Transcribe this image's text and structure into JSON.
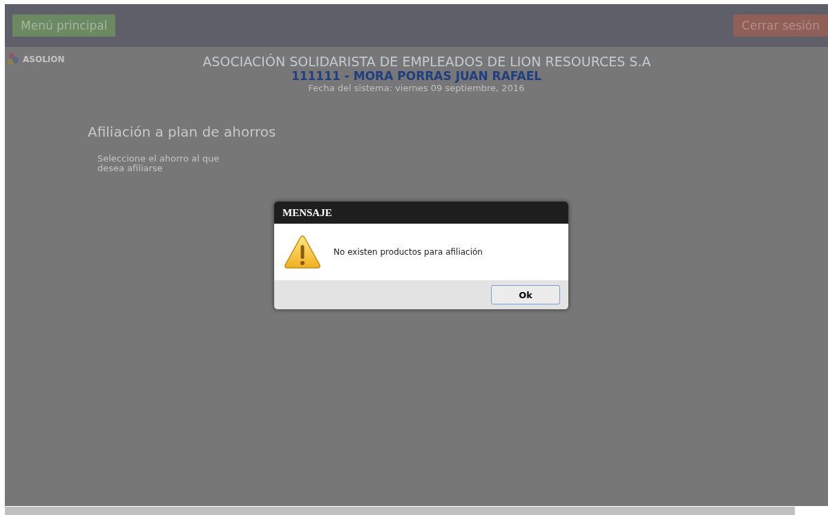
{
  "top_bar": {
    "menu_button": "Menú principal",
    "logout_button": "Cerrar sesión"
  },
  "header": {
    "logo_text": "ASOLION",
    "organization": "ASOCIACIÓN SOLIDARISTA DE EMPLEADOS DE LION RESOURCES S.A",
    "user": "111111 - MORA PORRAS JUAN RAFAEL",
    "system_date": "Fecha del sistema: viernes 09 septiembre, 2016"
  },
  "content": {
    "title": "Afiliación a plan de ahorros",
    "instruction": "Seleccione el ahorro al que desea afiliarse"
  },
  "dialog": {
    "title": "MENSAJE",
    "kind": "warning",
    "message": "No existen productos para afiliación",
    "buttons": [
      "Ok"
    ]
  }
}
